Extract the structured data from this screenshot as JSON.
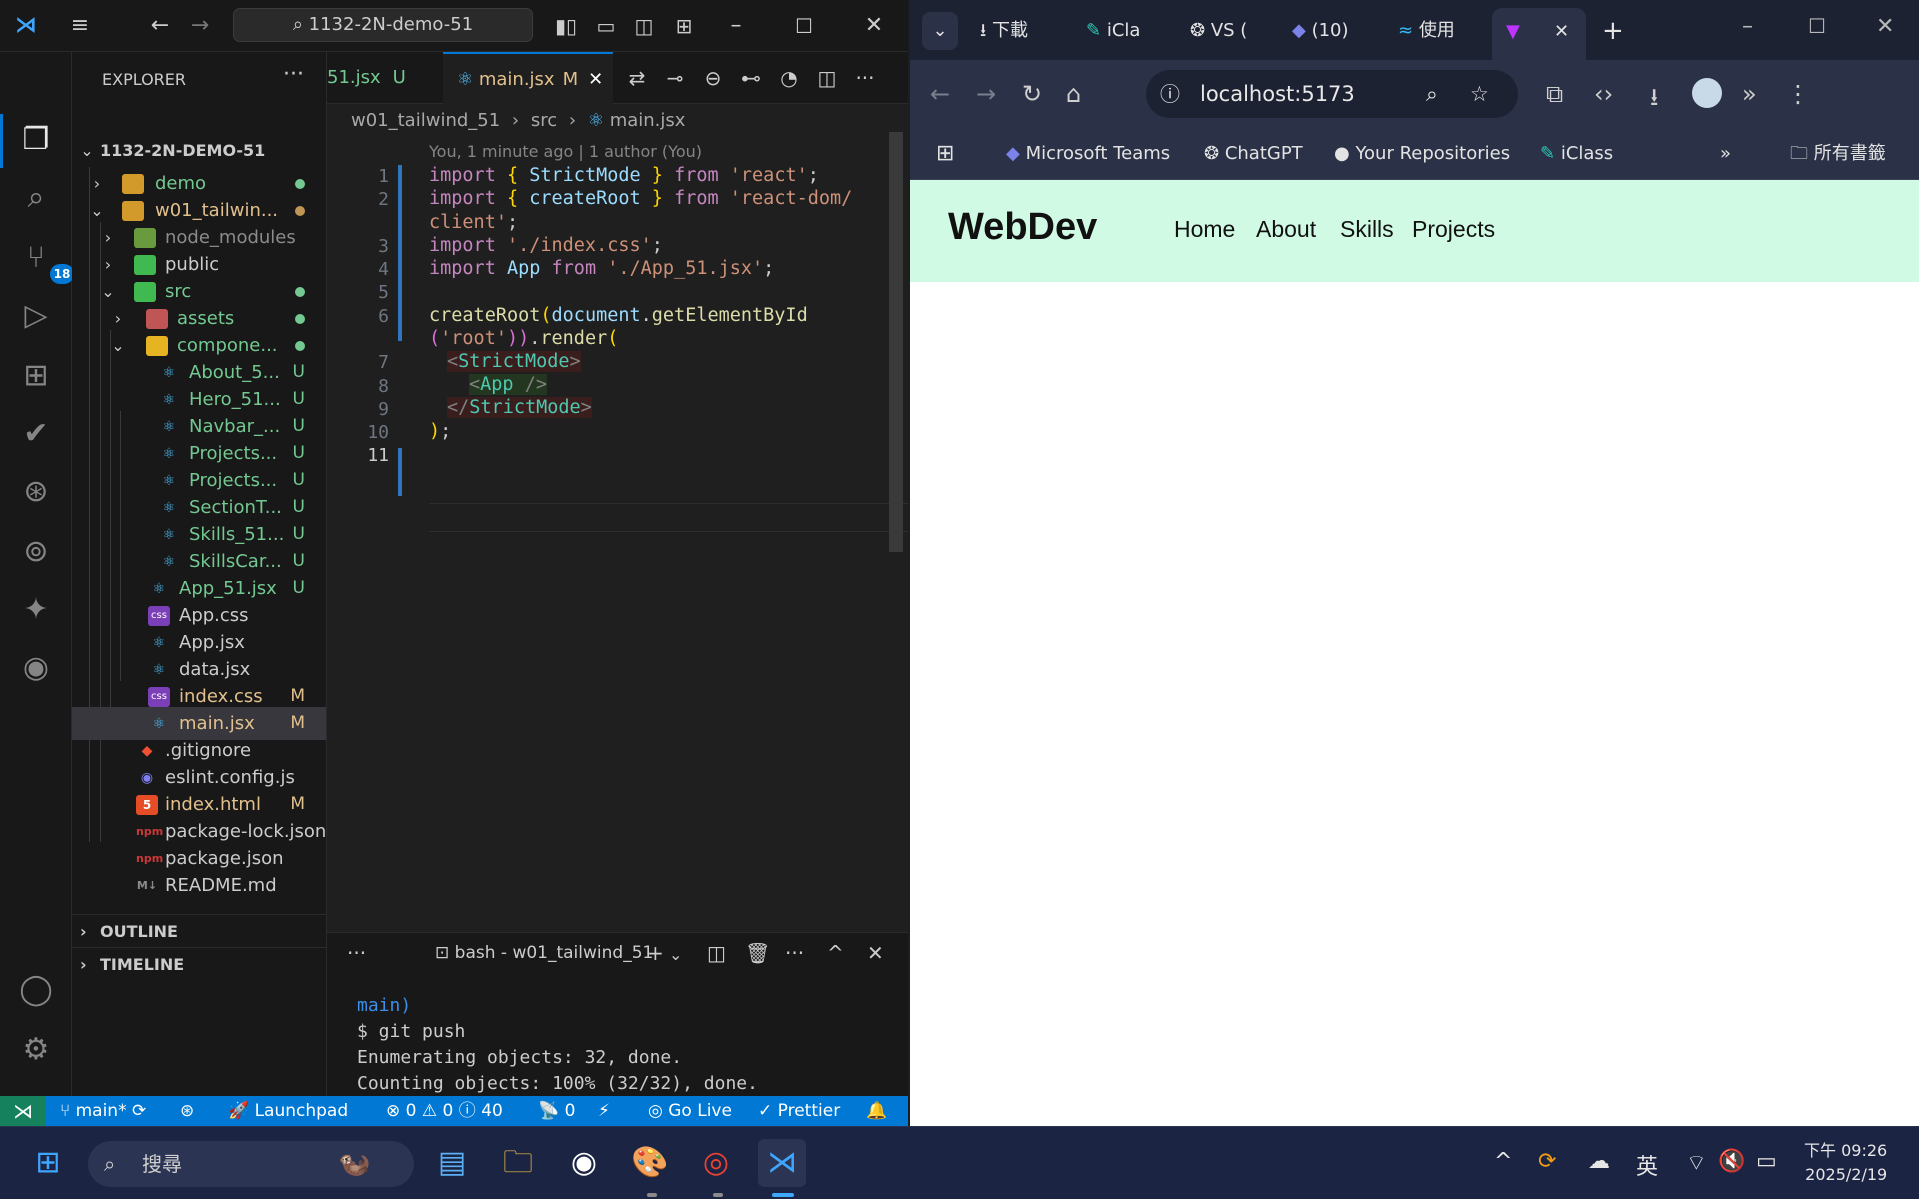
{
  "vscode": {
    "command_center": "1132-2N-demo-51",
    "activity_badge": "18",
    "explorer": {
      "title": "EXPLORER",
      "root": "1132-2N-DEMO-51",
      "items": [
        {
          "name": "demo",
          "status": ""
        },
        {
          "name": "w01_tailwin...",
          "status": ""
        },
        {
          "name": "node_modules",
          "status": ""
        },
        {
          "name": "public",
          "status": ""
        },
        {
          "name": "src",
          "status": ""
        },
        {
          "name": "assets",
          "status": ""
        },
        {
          "name": "compone...",
          "status": ""
        },
        {
          "name": "About_5...",
          "status": "U"
        },
        {
          "name": "Hero_51...",
          "status": "U"
        },
        {
          "name": "Navbar_...",
          "status": "U"
        },
        {
          "name": "Projects...",
          "status": "U"
        },
        {
          "name": "Projects...",
          "status": "U"
        },
        {
          "name": "SectionT...",
          "status": "U"
        },
        {
          "name": "Skills_51...",
          "status": "U"
        },
        {
          "name": "SkillsCar...",
          "status": "U"
        },
        {
          "name": "App_51.jsx",
          "status": "U"
        },
        {
          "name": "App.css",
          "status": ""
        },
        {
          "name": "App.jsx",
          "status": ""
        },
        {
          "name": "data.jsx",
          "status": ""
        },
        {
          "name": "index.css",
          "status": "M"
        },
        {
          "name": "main.jsx",
          "status": "M"
        },
        {
          "name": ".gitignore",
          "status": ""
        },
        {
          "name": "eslint.config.js",
          "status": ""
        },
        {
          "name": "index.html",
          "status": "M"
        },
        {
          "name": "package-lock.json",
          "status": ""
        },
        {
          "name": "package.json",
          "status": ""
        },
        {
          "name": "README.md",
          "status": ""
        }
      ],
      "outline": "OUTLINE",
      "timeline": "TIMELINE"
    },
    "tabs": [
      {
        "label": "51.jsx",
        "status": "U"
      },
      {
        "label": "main.jsx",
        "status": "M"
      }
    ],
    "breadcrumb": {
      "folder": "w01_tailwind_51",
      "sub": "src",
      "file": "main.jsx"
    },
    "codelens": "You, 1 minute ago | 1 author (You)",
    "line_numbers": [
      "1",
      "2",
      "3",
      "4",
      "5",
      "6",
      "7",
      "8",
      "9",
      "10",
      "11"
    ],
    "code": {
      "l1": [
        "import",
        " { ",
        "StrictMode",
        " } ",
        "from",
        " ",
        "'react'",
        ";"
      ],
      "l2a": [
        "import",
        " { ",
        "createRoot",
        " } ",
        "from",
        " ",
        "'react-dom/"
      ],
      "l2b": [
        "client'",
        ";"
      ],
      "l3": [
        "import",
        " ",
        "'./index.css'",
        ";"
      ],
      "l4": [
        "import",
        " ",
        "App",
        " ",
        "from",
        " ",
        "'./App_51.jsx'",
        ";"
      ],
      "l6a": [
        "createRoot",
        "(",
        "document",
        ".",
        "getElementById"
      ],
      "l6b": [
        "(",
        "'root'",
        "))",
        ".",
        "render",
        "("
      ],
      "l7": [
        "<",
        "StrictMode",
        ">"
      ],
      "l8": [
        "<",
        "App",
        " />"
      ],
      "l9": [
        "</",
        "StrictMode",
        ">"
      ],
      "l10": [
        ")",
        ";"
      ]
    },
    "terminal": {
      "title": "bash - w01_tailwind_51",
      "lines": [
        "main)",
        "$ git push",
        "Enumerating objects: 32, done.",
        "Counting objects: 100% (32/32), done."
      ]
    },
    "status": {
      "branch": "main*",
      "launchpad": "Launchpad",
      "errors": "0",
      "warnings": "0",
      "infos": "40",
      "ports": "0",
      "golive": "Go Live",
      "prettier": "Prettier"
    }
  },
  "browser": {
    "tabs": [
      "下載",
      "iCla",
      "VS (",
      "(10)",
      "使用",
      ""
    ],
    "url": "localhost:5173",
    "bookmarks": [
      "Microsoft Teams",
      "ChatGPT",
      "Your Repositories",
      "iClass"
    ],
    "all_bookmarks": "所有書籤",
    "site": {
      "logo": "WebDev",
      "nav": [
        "Home",
        "About",
        "Skills",
        "Projects"
      ]
    }
  },
  "taskbar": {
    "search": "搜尋",
    "ime": "英",
    "time": "下午 09:26",
    "date": "2025/2/19"
  }
}
